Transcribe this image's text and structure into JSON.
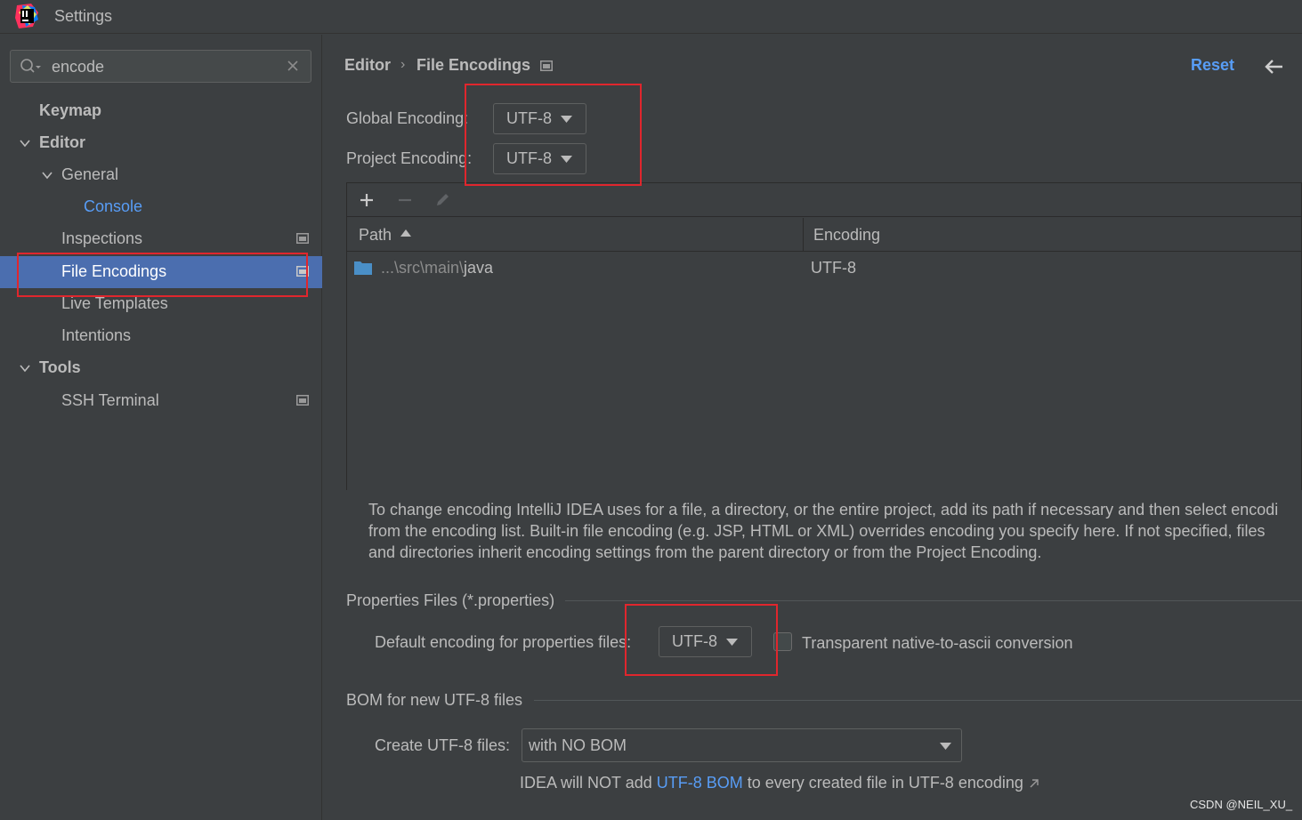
{
  "window": {
    "title": "Settings"
  },
  "sidebar": {
    "search": {
      "value": "encode"
    },
    "items": [
      {
        "label": "Keymap"
      },
      {
        "label": "Editor"
      },
      {
        "label": "General"
      },
      {
        "label": "Console"
      },
      {
        "label": "Inspections"
      },
      {
        "label": "File Encodings"
      },
      {
        "label": "Live Templates"
      },
      {
        "label": "Intentions"
      },
      {
        "label": "Tools"
      },
      {
        "label": "SSH Terminal"
      }
    ]
  },
  "header": {
    "breadcrumb": [
      "Editor",
      "File Encodings"
    ],
    "reset_label": "Reset"
  },
  "encodings": {
    "global_label": "Global Encoding:",
    "global_value": "UTF-8",
    "project_label": "Project Encoding:",
    "project_value": "UTF-8"
  },
  "table": {
    "columns": [
      "Path",
      "Encoding"
    ],
    "rows": [
      {
        "path_prefix": "...\\src\\main\\",
        "path_name": "java",
        "encoding": "UTF-8"
      }
    ]
  },
  "help_lines": [
    "To change encoding IntelliJ IDEA uses for a file, a directory, or the entire project, add its path if necessary and then select encodi",
    "from the encoding list. Built-in file encoding (e.g. JSP, HTML or XML) overrides encoding you specify here. If not specified, files",
    "and directories inherit encoding settings from the parent directory or from the Project Encoding."
  ],
  "properties": {
    "section_title": "Properties Files (*.properties)",
    "default_label": "Default encoding for properties files:",
    "default_value": "UTF-8",
    "transparent_label": "Transparent native-to-ascii conversion",
    "transparent_checked": false
  },
  "bom": {
    "section_title": "BOM for new UTF-8 files",
    "create_label": "Create UTF-8 files:",
    "create_value": "with NO BOM",
    "note_prefix": "IDEA will NOT add ",
    "note_link": "UTF-8 BOM",
    "note_suffix": " to every created file in UTF-8 encoding"
  },
  "watermark": "CSDN @NEIL_XU_",
  "colors": {
    "background": "#3c3f41",
    "selection": "#4b6eaf",
    "link": "#589df6",
    "highlight_box": "#e0262d"
  }
}
